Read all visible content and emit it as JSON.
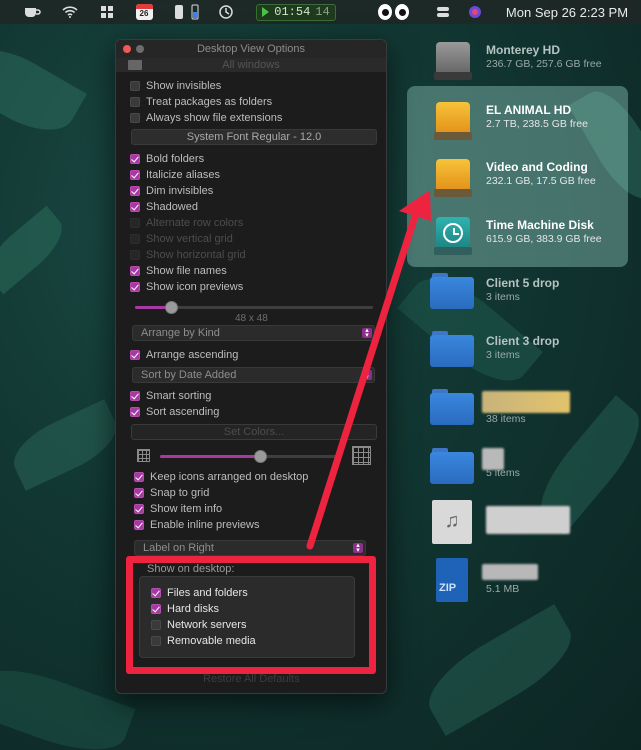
{
  "menubar": {
    "calendar_day": "26",
    "timer_main": "01:54",
    "timer_seconds": "14",
    "datetime": "Mon Sep 26  2:23 PM"
  },
  "panel": {
    "title": "Desktop View Options",
    "scope": "All windows",
    "font_button": "System Font Regular - 12.0",
    "size_label": "48 x 48",
    "arrange_by": "Arrange by Kind",
    "sort_by": "Sort by Date Added",
    "set_colors": "Set Colors...",
    "label_position": "Label on Right",
    "show_on_desktop_title": "Show on desktop:",
    "restore_button": "Restore All Defaults",
    "options": [
      {
        "label": "Show invisibles",
        "checked": false,
        "enabled": true
      },
      {
        "label": "Treat packages as folders",
        "checked": false,
        "enabled": true
      },
      {
        "label": "Always show file extensions",
        "checked": false,
        "enabled": true
      },
      {
        "label": "Bold folders",
        "checked": true,
        "enabled": true
      },
      {
        "label": "Italicize aliases",
        "checked": true,
        "enabled": true
      },
      {
        "label": "Dim invisibles",
        "checked": true,
        "enabled": true
      },
      {
        "label": "Shadowed",
        "checked": true,
        "enabled": true
      },
      {
        "label": "Alternate row colors",
        "checked": false,
        "enabled": false
      },
      {
        "label": "Show vertical grid",
        "checked": false,
        "enabled": false
      },
      {
        "label": "Show horizontal grid",
        "checked": false,
        "enabled": false
      },
      {
        "label": "Show file names",
        "checked": true,
        "enabled": true
      },
      {
        "label": "Show icon previews",
        "checked": true,
        "enabled": true
      },
      {
        "label": "Arrange ascending",
        "checked": true,
        "enabled": true
      },
      {
        "label": "Smart sorting",
        "checked": true,
        "enabled": true
      },
      {
        "label": "Sort ascending",
        "checked": true,
        "enabled": true
      },
      {
        "label": "Keep icons arranged on desktop",
        "checked": true,
        "enabled": true
      },
      {
        "label": "Snap to grid",
        "checked": true,
        "enabled": true
      },
      {
        "label": "Show item info",
        "checked": true,
        "enabled": true
      },
      {
        "label": "Enable inline previews",
        "checked": true,
        "enabled": true
      }
    ],
    "show_on_desktop": [
      {
        "label": "Files and folders",
        "checked": true
      },
      {
        "label": "Hard disks",
        "checked": true
      },
      {
        "label": "Network servers",
        "checked": false
      },
      {
        "label": "Removable media",
        "checked": false
      }
    ],
    "icon_size_fraction": 0.15,
    "grid_spacing_fraction": 0.55
  },
  "desktop": {
    "items": [
      {
        "name": "Monterey HD",
        "info": "236.7 GB, 257.6 GB free",
        "icon": "hard-disk-icon",
        "selected": false
      },
      {
        "name": "EL ANIMAL HD",
        "info": "2.7 TB, 238.5 GB free",
        "icon": "external-disk-icon",
        "selected": true
      },
      {
        "name": "Video and Coding",
        "info": "232.1 GB, 17.5 GB free",
        "icon": "external-disk-icon",
        "selected": true
      },
      {
        "name": "Time Machine Disk",
        "info": "615.9 GB, 383.9 GB free",
        "icon": "time-machine-disk-icon",
        "selected": true
      },
      {
        "name": "Client 5 drop",
        "info": "3 items",
        "icon": "folder-icon",
        "selected": false
      },
      {
        "name": "Client 3 drop",
        "info": "3 items",
        "icon": "folder-icon",
        "selected": false
      },
      {
        "name": "",
        "info": "38 items",
        "icon": "folder-icon",
        "selected": false
      },
      {
        "name": "",
        "info": "5 items",
        "icon": "folder-icon",
        "selected": false
      },
      {
        "name": "",
        "info": "",
        "icon": "audio-file-icon",
        "selected": false
      },
      {
        "name": "",
        "info": "5.1 MB",
        "icon": "zip-file-icon",
        "selected": false
      }
    ]
  },
  "colors": {
    "accent": "#a63aa2",
    "annotation": "#ee2340",
    "selection": "#9fdcd2"
  }
}
